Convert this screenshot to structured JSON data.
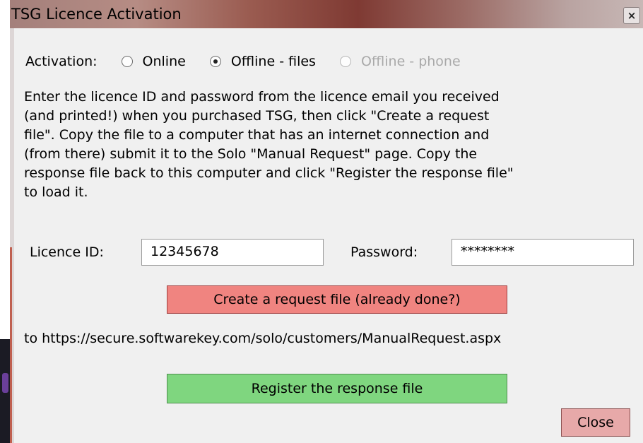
{
  "window": {
    "title": "TSG Licence Activation",
    "close_glyph": "×"
  },
  "activation": {
    "label": "Activation:",
    "options": [
      {
        "label": "Online",
        "selected": false,
        "enabled": true
      },
      {
        "label": "Offline - files",
        "selected": true,
        "enabled": true
      },
      {
        "label": "Offline - phone",
        "selected": false,
        "enabled": false
      }
    ]
  },
  "instructions": "Enter the licence ID and password from the licence email you received\n(and printed!) when you purchased TSG, then click \"Create a request\nfile\".   Copy the file to a computer that has an internet connection and\n(from there) submit it to the Solo \"Manual Request\" page.   Copy the\nresponse file back to this computer and click \"Register the response file\"\nto load it.",
  "licence_id": {
    "label": "Licence ID:",
    "value": "12345678"
  },
  "password": {
    "label": "Password:",
    "value": "********"
  },
  "buttons": {
    "create_request": "Create a request file (already done?)",
    "register_response": "Register the response file",
    "close": "Close"
  },
  "url_text": "to https://secure.softwarekey.com/solo/customers/ManualRequest.aspx",
  "colors": {
    "create_button": "#f08480",
    "register_button": "#7fd67f",
    "close_button": "#e7a9a9"
  }
}
